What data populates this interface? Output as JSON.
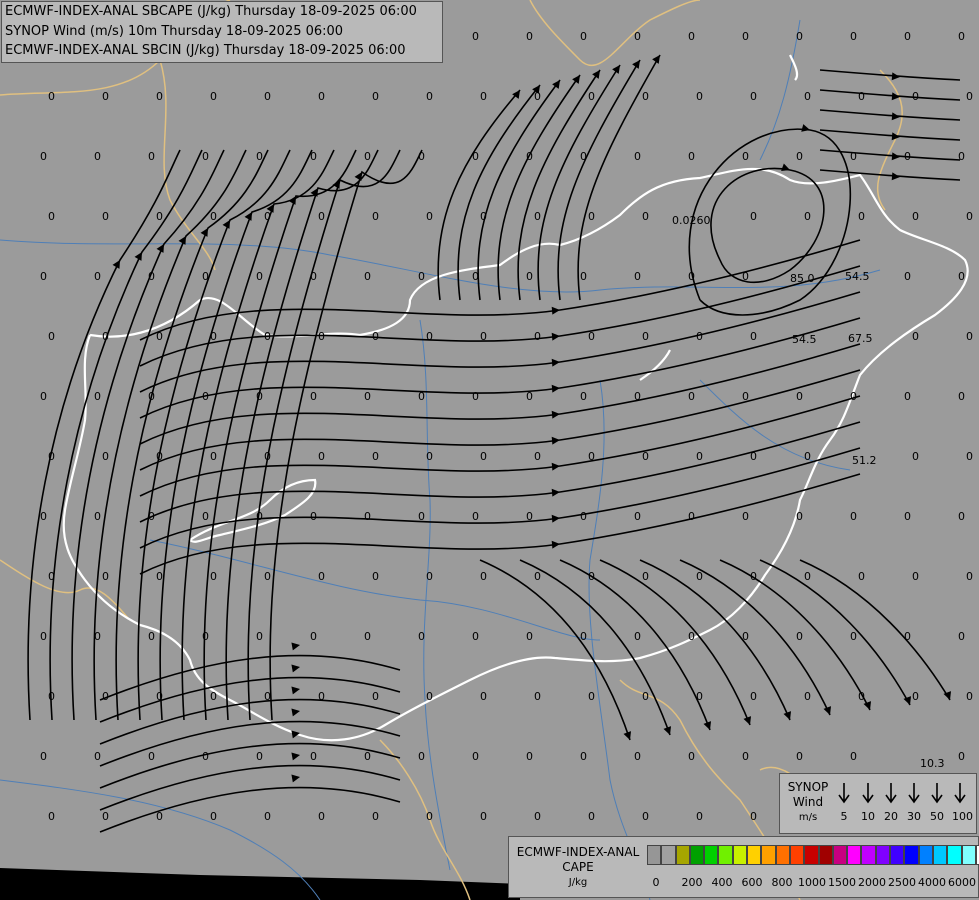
{
  "title_lines": [
    "ECMWF-INDEX-ANAL SBCAPE (J/kg) Thursday 18-09-2025 06:00",
    "SYNOP Wind (m/s) 10m Thursday 18-09-2025 06:00",
    "ECMWF-INDEX-ANAL SBCIN (J/kg) Thursday 18-09-2025 06:00"
  ],
  "colors": {
    "background": "#9b9b9b",
    "border_white": "#ffffff",
    "border_tan": "#e0c080",
    "rivers": "#4f7fb7",
    "streamlines": "#000000",
    "sea_band": "#000000"
  },
  "grid_values": {
    "zero_label": "0",
    "nonzero": [
      {
        "text": "0.0260"
      },
      {
        "text": "85.0"
      },
      {
        "text": "54.5"
      },
      {
        "text": "54.5"
      },
      {
        "text": "67.5"
      },
      {
        "text": "51.2"
      },
      {
        "text": "10.3"
      }
    ]
  },
  "synop_legend": {
    "label_line1": "SYNOP",
    "label_line2": "Wind",
    "unit": "m/s",
    "barbs": [
      {
        "speed": "5"
      },
      {
        "speed": "10"
      },
      {
        "speed": "20"
      },
      {
        "speed": "30"
      },
      {
        "speed": "50"
      },
      {
        "speed": "100"
      }
    ]
  },
  "cape_legend": {
    "title_line1": "ECMWF-INDEX-ANAL",
    "title_line2": "CAPE",
    "unit": "J/kg",
    "colors": [
      "#969696",
      "#a0a0a0",
      "#a6a600",
      "#00a000",
      "#00d000",
      "#70f000",
      "#c8f000",
      "#ffd000",
      "#ffa000",
      "#ff7000",
      "#ff4000",
      "#c80000",
      "#a00000",
      "#c80080",
      "#ff00ff",
      "#c000ff",
      "#8000ff",
      "#4000ff",
      "#0000ff",
      "#0080ff",
      "#00c8ff",
      "#00ffff",
      "#80ffff",
      "#ffffff"
    ],
    "ticks": [
      "0",
      "200",
      "400",
      "600",
      "800",
      "1000",
      "1500",
      "2000",
      "2500",
      "4000",
      "6000"
    ]
  }
}
